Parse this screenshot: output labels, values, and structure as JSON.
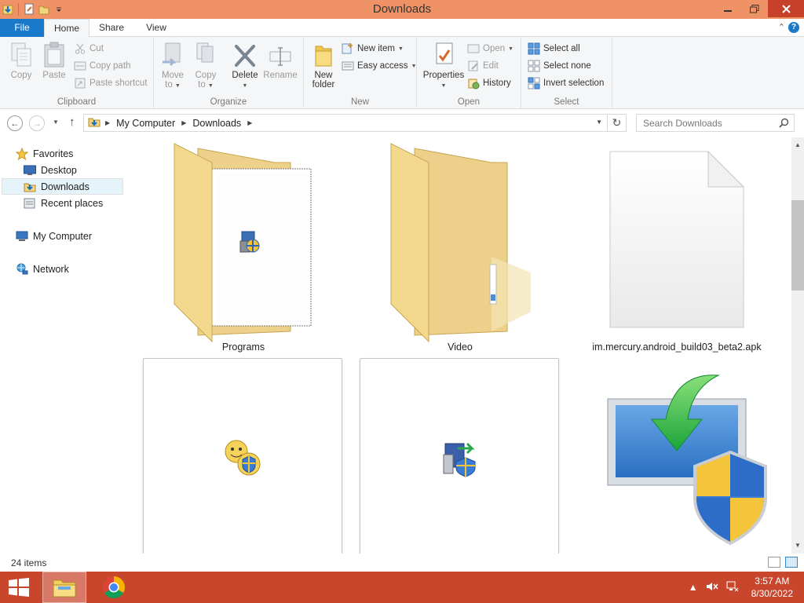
{
  "window": {
    "title": "Downloads"
  },
  "tabs": {
    "file": "File",
    "home": "Home",
    "share": "Share",
    "view": "View"
  },
  "ribbon": {
    "clipboard": {
      "label": "Clipboard",
      "copy": "Copy",
      "paste": "Paste",
      "cut": "Cut",
      "copy_path": "Copy path",
      "paste_shortcut": "Paste shortcut"
    },
    "organize": {
      "label": "Organize",
      "move_to_1": "Move",
      "move_to_2": "to",
      "copy_to_1": "Copy",
      "copy_to_2": "to",
      "delete": "Delete",
      "rename": "Rename"
    },
    "new": {
      "label": "New",
      "new_folder_1": "New",
      "new_folder_2": "folder",
      "new_item": "New item",
      "easy_access": "Easy access"
    },
    "open": {
      "label": "Open",
      "properties": "Properties",
      "open": "Open",
      "edit": "Edit",
      "history": "History"
    },
    "select": {
      "label": "Select",
      "select_all": "Select all",
      "select_none": "Select none",
      "invert_selection": "Invert selection"
    }
  },
  "address": {
    "crumbs": [
      "My Computer",
      "Downloads"
    ],
    "search_placeholder": "Search Downloads"
  },
  "nav": {
    "favorites": "Favorites",
    "desktop": "Desktop",
    "downloads": "Downloads",
    "recent_places": "Recent places",
    "my_computer": "My Computer",
    "network": "Network"
  },
  "files": [
    {
      "name": "Programs",
      "type": "folder-with-document"
    },
    {
      "name": "Video",
      "type": "folder"
    },
    {
      "name": "im.mercury.android_build03_beta2.apk",
      "type": "blank-file"
    },
    {
      "name": "",
      "type": "installer-smiley"
    },
    {
      "name": "",
      "type": "installer-setup"
    },
    {
      "name": "",
      "type": "windows-update-installer"
    }
  ],
  "status": {
    "item_count": "24 items"
  },
  "taskbar": {
    "time": "3:57 AM",
    "date": "8/30/2022"
  },
  "colors": {
    "titlebar": "#ef9366",
    "taskbar": "#c8462b",
    "file_tab": "#1979ca",
    "accent": "#1979ca"
  }
}
